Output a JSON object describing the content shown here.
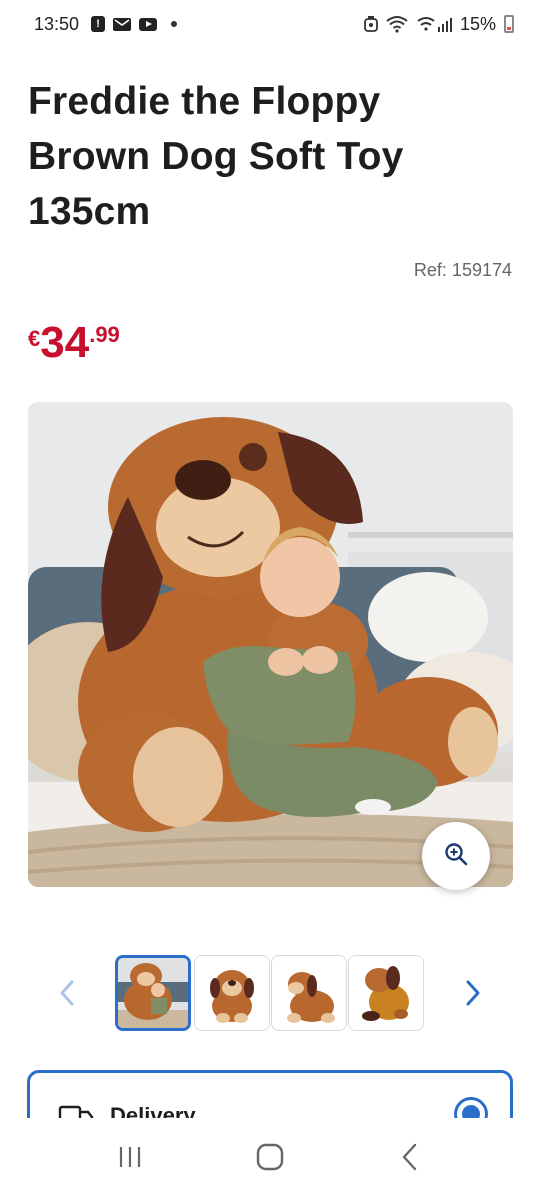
{
  "status_bar": {
    "time": "13:50",
    "battery": "15%",
    "icons": [
      "notification-icon",
      "mail-icon",
      "youtube-icon",
      "dot-icon",
      "alarm-icon",
      "wifi-icon",
      "signal-icon",
      "battery-icon"
    ]
  },
  "product": {
    "title": "Freddie the Floppy Brown Dog Soft Toy 135cm",
    "ref": "Ref: 159174",
    "price": {
      "currency": "€",
      "main": "34",
      "cents": ".99",
      "color": "#c8102e"
    }
  },
  "gallery": {
    "thumbnail_count": 4,
    "selected_index": 0,
    "accent": "#2a6ec9"
  },
  "delivery": {
    "label": "Delivery",
    "selected": true
  },
  "nav": {
    "icons": [
      "recents-icon",
      "home-icon",
      "back-icon"
    ]
  }
}
